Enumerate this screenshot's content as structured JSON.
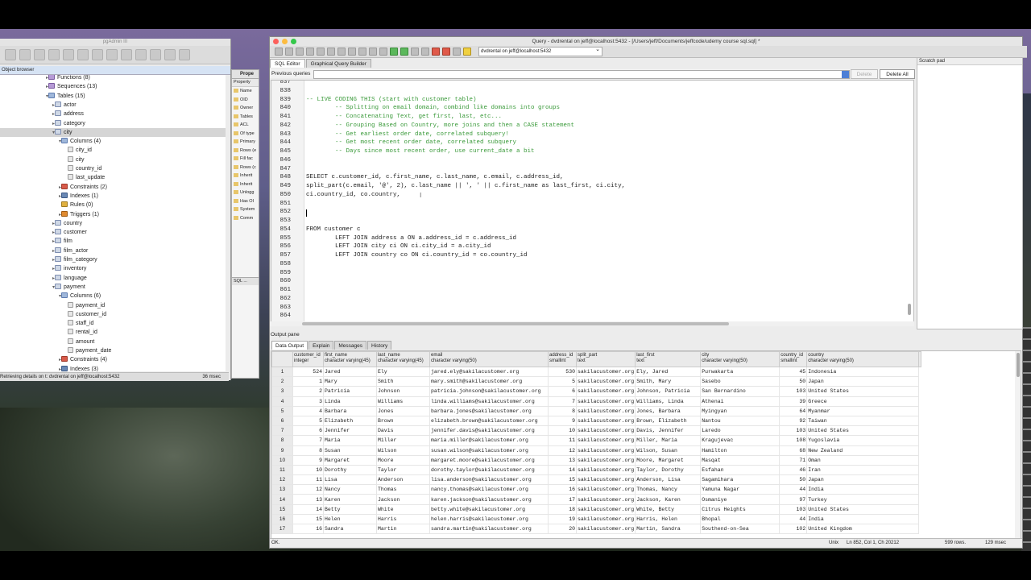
{
  "pgadmin": {
    "title": "pgAdmin III",
    "object_browser_label": "Object browser",
    "tree": [
      {
        "label": "Functions (8)",
        "indent": 1,
        "toggle": "▸",
        "icon": "fn"
      },
      {
        "label": "Sequences (13)",
        "indent": 1,
        "toggle": "▸",
        "icon": "fn"
      },
      {
        "label": "Tables (15)",
        "indent": 1,
        "toggle": "▾",
        "icon": "grp"
      },
      {
        "label": "actor",
        "indent": 2,
        "toggle": "▸",
        "icon": "tbl"
      },
      {
        "label": "address",
        "indent": 2,
        "toggle": "▸",
        "icon": "tbl"
      },
      {
        "label": "category",
        "indent": 2,
        "toggle": "▸",
        "icon": "tbl"
      },
      {
        "label": "city",
        "indent": 2,
        "toggle": "▾",
        "icon": "tbl",
        "selected": true
      },
      {
        "label": "Columns (4)",
        "indent": 3,
        "toggle": "▾",
        "icon": "grp"
      },
      {
        "label": "city_id",
        "indent": 4,
        "toggle": "",
        "icon": "col"
      },
      {
        "label": "city",
        "indent": 4,
        "toggle": "",
        "icon": "col"
      },
      {
        "label": "country_id",
        "indent": 4,
        "toggle": "",
        "icon": "col"
      },
      {
        "label": "last_update",
        "indent": 4,
        "toggle": "",
        "icon": "col"
      },
      {
        "label": "Constraints (2)",
        "indent": 3,
        "toggle": "▸",
        "icon": "con"
      },
      {
        "label": "Indexes (1)",
        "indent": 3,
        "toggle": "▸",
        "icon": "idx"
      },
      {
        "label": "Rules (0)",
        "indent": 3,
        "toggle": "",
        "icon": "rul"
      },
      {
        "label": "Triggers (1)",
        "indent": 3,
        "toggle": "▸",
        "icon": "trg"
      },
      {
        "label": "country",
        "indent": 2,
        "toggle": "▸",
        "icon": "tbl"
      },
      {
        "label": "customer",
        "indent": 2,
        "toggle": "▸",
        "icon": "tbl"
      },
      {
        "label": "film",
        "indent": 2,
        "toggle": "▸",
        "icon": "tbl"
      },
      {
        "label": "film_actor",
        "indent": 2,
        "toggle": "▸",
        "icon": "tbl"
      },
      {
        "label": "film_category",
        "indent": 2,
        "toggle": "▸",
        "icon": "tbl"
      },
      {
        "label": "inventory",
        "indent": 2,
        "toggle": "▸",
        "icon": "tbl"
      },
      {
        "label": "language",
        "indent": 2,
        "toggle": "▸",
        "icon": "tbl"
      },
      {
        "label": "payment",
        "indent": 2,
        "toggle": "▾",
        "icon": "tbl"
      },
      {
        "label": "Columns (6)",
        "indent": 3,
        "toggle": "▾",
        "icon": "grp"
      },
      {
        "label": "payment_id",
        "indent": 4,
        "toggle": "",
        "icon": "col"
      },
      {
        "label": "customer_id",
        "indent": 4,
        "toggle": "",
        "icon": "col"
      },
      {
        "label": "staff_id",
        "indent": 4,
        "toggle": "",
        "icon": "col"
      },
      {
        "label": "rental_id",
        "indent": 4,
        "toggle": "",
        "icon": "col"
      },
      {
        "label": "amount",
        "indent": 4,
        "toggle": "",
        "icon": "col"
      },
      {
        "label": "payment_date",
        "indent": 4,
        "toggle": "",
        "icon": "col"
      },
      {
        "label": "Constraints (4)",
        "indent": 3,
        "toggle": "▸",
        "icon": "con"
      },
      {
        "label": "Indexes (3)",
        "indent": 3,
        "toggle": "▸",
        "icon": "idx"
      }
    ],
    "status_left": "Retrieving details on t: dvdrental on jeff@localhost:5432",
    "status_right": "36 msec",
    "props_tab": "Prope",
    "props_header": "Property",
    "props_items": [
      "Name",
      "OID",
      "Owner",
      "Tables",
      "ACL",
      "Of type",
      "Primary",
      "Rows (e",
      "Fill fac",
      "Rows (c",
      "Inherit",
      "Inherit",
      "Unlogg",
      "Has OI",
      "System",
      "Comm"
    ],
    "sql_tab": "SQL ..."
  },
  "query": {
    "title": "Query - dvdrental on jeff@localhost:5432 - [/Users/jeff/Documents/jeffcode/udemy course sql.sql] *",
    "connection": "dvdrental on jeff@localhost:5432",
    "tabs": [
      "SQL Editor",
      "Graphical Query Builder"
    ],
    "previous_queries_label": "Previous queries",
    "delete_label": "Delete",
    "delete_all_label": "Delete All",
    "scratch_pad_label": "Scratch pad",
    "lines": [
      {
        "n": "837",
        "t": "",
        "c": "plain"
      },
      {
        "n": "838",
        "t": "",
        "c": "plain"
      },
      {
        "n": "839",
        "t": "-- LIVE CODING THIS (start with customer table)",
        "c": "cm"
      },
      {
        "n": "840",
        "t": "        -- Splitting on email domain, combind like domains into groups",
        "c": "cm"
      },
      {
        "n": "841",
        "t": "        -- Concatenating Text, get first, last, etc...",
        "c": "cm"
      },
      {
        "n": "842",
        "t": "        -- Grouping Based on Country, more joins and then a CASE statement",
        "c": "cm"
      },
      {
        "n": "843",
        "t": "        -- Get earliest order date, correlated subquery!",
        "c": "cm"
      },
      {
        "n": "844",
        "t": "        -- Get most recent order date, correlated subquery",
        "c": "cm"
      },
      {
        "n": "845",
        "t": "        -- Days since most recent order, use current_date a bit",
        "c": "cm"
      },
      {
        "n": "846",
        "t": "",
        "c": "plain"
      },
      {
        "n": "847",
        "t": "",
        "c": "plain"
      },
      {
        "n": "848",
        "t": "SELECT c.customer_id, c.first_name, c.last_name, c.email, c.address_id,",
        "c": "plain"
      },
      {
        "n": "849",
        "t": "split_part(c.email, '@', 2), c.last_name || ', ' || c.first_name as last_first, ci.city,",
        "c": "plain"
      },
      {
        "n": "850",
        "t": "ci.country_id, co.country,",
        "c": "plain"
      },
      {
        "n": "851",
        "t": "",
        "c": "plain"
      },
      {
        "n": "852",
        "t": "",
        "c": "plain"
      },
      {
        "n": "853",
        "t": "",
        "c": "plain"
      },
      {
        "n": "854",
        "t": "FROM customer c",
        "c": "plain"
      },
      {
        "n": "855",
        "t": "        LEFT JOIN address a ON a.address_id = c.address_id",
        "c": "plain"
      },
      {
        "n": "856",
        "t": "        LEFT JOIN city ci ON ci.city_id = a.city_id",
        "c": "plain"
      },
      {
        "n": "857",
        "t": "        LEFT JOIN country co ON ci.country_id = co.country_id",
        "c": "plain"
      },
      {
        "n": "858",
        "t": "",
        "c": "plain"
      },
      {
        "n": "859",
        "t": "",
        "c": "plain"
      },
      {
        "n": "860",
        "t": "",
        "c": "plain"
      },
      {
        "n": "861",
        "t": "",
        "c": "plain"
      },
      {
        "n": "862",
        "t": "",
        "c": "plain"
      },
      {
        "n": "863",
        "t": "",
        "c": "plain"
      },
      {
        "n": "864",
        "t": "",
        "c": "plain"
      }
    ],
    "output_pane_label": "Output pane",
    "output_tabs": [
      "Data Output",
      "Explain",
      "Messages",
      "History"
    ],
    "columns": [
      {
        "name": "customer_id",
        "type": "integer"
      },
      {
        "name": "first_name",
        "type": "character varying(45)"
      },
      {
        "name": "last_name",
        "type": "character varying(45)"
      },
      {
        "name": "email",
        "type": "character varying(50)"
      },
      {
        "name": "address_id",
        "type": "smallint"
      },
      {
        "name": "split_part",
        "type": "text"
      },
      {
        "name": "last_first",
        "type": "text"
      },
      {
        "name": "city",
        "type": "character varying(50)"
      },
      {
        "name": "country_id",
        "type": "smallint"
      },
      {
        "name": "country",
        "type": "character varying(50)"
      }
    ],
    "rows": [
      [
        "524",
        "Jared",
        "Ely",
        "jared.ely@sakilacustomer.org",
        "530",
        "sakilacustomer.org",
        "Ely, Jared",
        "Purwakarta",
        "45",
        "Indonesia"
      ],
      [
        "1",
        "Mary",
        "Smith",
        "mary.smith@sakilacustomer.org",
        "5",
        "sakilacustomer.org",
        "Smith, Mary",
        "Sasebo",
        "50",
        "Japan"
      ],
      [
        "2",
        "Patricia",
        "Johnson",
        "patricia.johnson@sakilacustomer.org",
        "6",
        "sakilacustomer.org",
        "Johnson, Patricia",
        "San Bernardino",
        "103",
        "United States"
      ],
      [
        "3",
        "Linda",
        "Williams",
        "linda.williams@sakilacustomer.org",
        "7",
        "sakilacustomer.org",
        "Williams, Linda",
        "Athenai",
        "39",
        "Greece"
      ],
      [
        "4",
        "Barbara",
        "Jones",
        "barbara.jones@sakilacustomer.org",
        "8",
        "sakilacustomer.org",
        "Jones, Barbara",
        "Myingyan",
        "64",
        "Myanmar"
      ],
      [
        "5",
        "Elizabeth",
        "Brown",
        "elizabeth.brown@sakilacustomer.org",
        "9",
        "sakilacustomer.org",
        "Brown, Elizabeth",
        "Nantou",
        "92",
        "Taiwan"
      ],
      [
        "6",
        "Jennifer",
        "Davis",
        "jennifer.davis@sakilacustomer.org",
        "10",
        "sakilacustomer.org",
        "Davis, Jennifer",
        "Laredo",
        "103",
        "United States"
      ],
      [
        "7",
        "Maria",
        "Miller",
        "maria.miller@sakilacustomer.org",
        "11",
        "sakilacustomer.org",
        "Miller, Maria",
        "Kragujevac",
        "108",
        "Yugoslavia"
      ],
      [
        "8",
        "Susan",
        "Wilson",
        "susan.wilson@sakilacustomer.org",
        "12",
        "sakilacustomer.org",
        "Wilson, Susan",
        "Hamilton",
        "68",
        "New Zealand"
      ],
      [
        "9",
        "Margaret",
        "Moore",
        "margaret.moore@sakilacustomer.org",
        "13",
        "sakilacustomer.org",
        "Moore, Margaret",
        "Masqat",
        "71",
        "Oman"
      ],
      [
        "10",
        "Dorothy",
        "Taylor",
        "dorothy.taylor@sakilacustomer.org",
        "14",
        "sakilacustomer.org",
        "Taylor, Dorothy",
        "Esfahan",
        "46",
        "Iran"
      ],
      [
        "11",
        "Lisa",
        "Anderson",
        "lisa.anderson@sakilacustomer.org",
        "15",
        "sakilacustomer.org",
        "Anderson, Lisa",
        "Sagamihara",
        "50",
        "Japan"
      ],
      [
        "12",
        "Nancy",
        "Thomas",
        "nancy.thomas@sakilacustomer.org",
        "16",
        "sakilacustomer.org",
        "Thomas, Nancy",
        "Yamuna Nagar",
        "44",
        "India"
      ],
      [
        "13",
        "Karen",
        "Jackson",
        "karen.jackson@sakilacustomer.org",
        "17",
        "sakilacustomer.org",
        "Jackson, Karen",
        "Osmaniye",
        "97",
        "Turkey"
      ],
      [
        "14",
        "Betty",
        "White",
        "betty.white@sakilacustomer.org",
        "18",
        "sakilacustomer.org",
        "White, Betty",
        "Citrus Heights",
        "103",
        "United States"
      ],
      [
        "15",
        "Helen",
        "Harris",
        "helen.harris@sakilacustomer.org",
        "19",
        "sakilacustomer.org",
        "Harris, Helen",
        "Bhopal",
        "44",
        "India"
      ],
      [
        "16",
        "Sandra",
        "Martin",
        "sandra.martin@sakilacustomer.org",
        "20",
        "sakilacustomer.org",
        "Martin, Sandra",
        "Southend-on-Sea",
        "102",
        "United Kingdom"
      ]
    ],
    "status": {
      "ok": "OK.",
      "eol": "Unix",
      "position": "Ln 852, Col 1, Ch 20212",
      "rows": "599 rows.",
      "time": "129 msec"
    }
  }
}
